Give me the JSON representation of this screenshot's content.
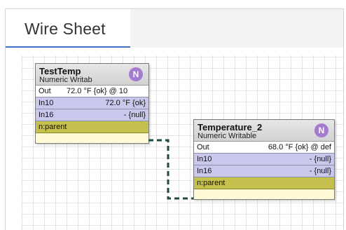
{
  "tab": {
    "label": "Wire Sheet"
  },
  "nodes": [
    {
      "title": "TestTemp",
      "type": "Numeric Writab",
      "badge": "N",
      "slots": {
        "out_name": "Out",
        "out_value": "72.0 °F {ok} @ 10",
        "in10_name": "In10",
        "in10_value": "72.0 °F {ok}",
        "in16_name": "In16",
        "in16_value": "- {null}",
        "parent_name": "n:parent"
      }
    },
    {
      "title": "Temperature_2",
      "type": "Numeric Writable",
      "badge": "N",
      "slots": {
        "out_name": "Out",
        "out_value": "68.0 °F {ok} @ def",
        "in10_name": "In10",
        "in10_value": "- {null}",
        "in16_name": "In16",
        "in16_value": "- {null}",
        "parent_name": "n:parent"
      }
    }
  ],
  "colors": {
    "tab_underline": "#3b74c9",
    "wire": "#1f4b3a",
    "badge": "#a37cd0",
    "parent_slot": "#c4c04e",
    "input_slot": "#c9c8ec"
  }
}
